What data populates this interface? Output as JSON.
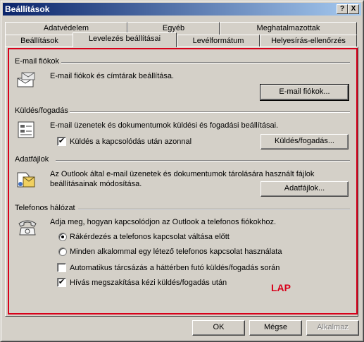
{
  "window": {
    "title": "Beállítások",
    "help_button": "?",
    "close_button": "X"
  },
  "tabs": {
    "row_back": [
      "Adatvédelem",
      "Egyéb",
      "Meghatalmazottak"
    ],
    "row_front": [
      "Beállítások",
      "Levelezés beállításai",
      "Levélformátum",
      "Helyesírás-ellenőrzés"
    ],
    "active": "Levelezés beállításai"
  },
  "sections": {
    "email": {
      "title": "E-mail fiókok",
      "desc": "E-mail fiókok és címtárak beállítása.",
      "button": "E-mail fiókok...",
      "icon": "email-accounts-icon"
    },
    "sendrecv": {
      "title": "Küldés/fogadás",
      "desc": "E-mail üzenetek és dokumentumok küldési és fogadási beállításai.",
      "checkbox_label": "Küldés a kapcsolódás után azonnal",
      "checkbox_checked": true,
      "button": "Küldés/fogadás...",
      "icon": "send-receive-icon"
    },
    "datafiles": {
      "title": "Adatfájlok",
      "desc_line1": "Az Outlook által e-mail üzenetek és dokumentumok tárolására használt fájlok",
      "desc_line2": "beállításainak módosítása.",
      "button": "Adatfájlok...",
      "icon": "data-files-icon"
    },
    "dialup": {
      "title": "Telefonos hálózat",
      "desc": "Adja meg, hogyan kapcsolódjon az Outlook a telefonos fiókokhoz.",
      "radio1": "Rákérdezés a telefonos kapcsolat váltása előtt",
      "radio1_selected": true,
      "radio2": "Minden alkalommal egy létező telefonos kapcsolat használata",
      "radio2_selected": false,
      "check1": "Automatikus tárcsázás a háttérben futó küldés/fogadás során",
      "check1_checked": false,
      "check2": "Hívás megszakítása kézi küldés/fogadás után",
      "check2_checked": true,
      "icon": "telephone-icon"
    }
  },
  "annotation": "LAP",
  "footer": {
    "ok": "OK",
    "cancel": "Mégse",
    "apply": "Alkalmaz"
  },
  "colors": {
    "titlebar_start": "#0a246a",
    "titlebar_end": "#a6caf0",
    "face": "#d4d0c8",
    "annotation_red": "#d8001a"
  }
}
